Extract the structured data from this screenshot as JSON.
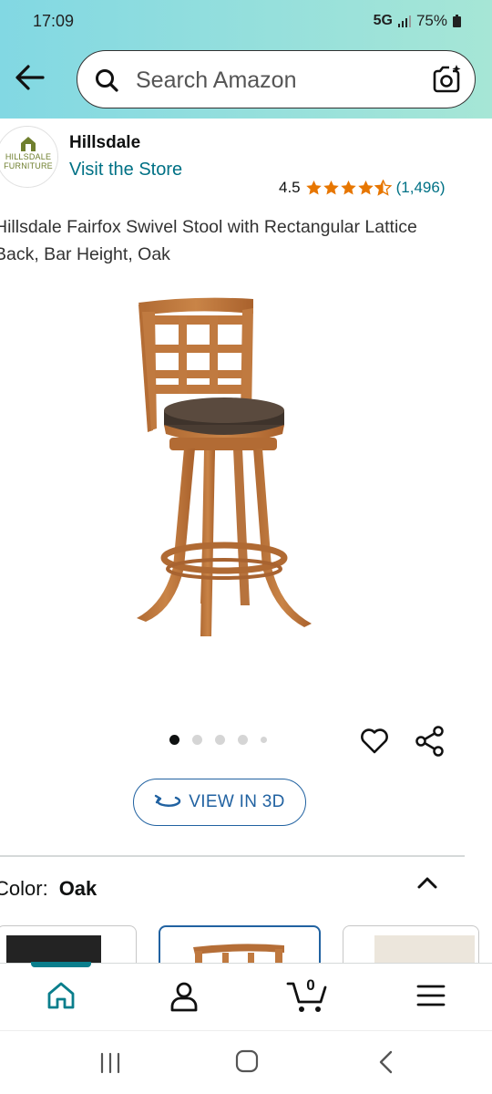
{
  "status_bar": {
    "time": "17:09",
    "network": "5G",
    "battery": "75%"
  },
  "search": {
    "placeholder": "Search Amazon"
  },
  "brand": {
    "name": "Hillsdale",
    "visit_store": "Visit the Store",
    "logo_text_line1": "HILLSDALE",
    "logo_text_line2": "FURNITURE"
  },
  "rating": {
    "value": "4.5",
    "stars": 4.5,
    "count": "(1,496)",
    "star_color": "#e77600"
  },
  "product": {
    "title": "Hillsdale Fairfox Swivel Stool with Rectangular Lattice Back, Bar Height, Oak"
  },
  "carousel": {
    "total_dots": 5,
    "active_index": 0
  },
  "view3d": {
    "label": "VIEW IN 3D",
    "icon": "rotate-3d-icon"
  },
  "color": {
    "label": "Color:",
    "value": "Oak"
  },
  "swatches": [
    {
      "name": "black",
      "color": "#232323"
    },
    {
      "name": "oak",
      "color": "#b8733a",
      "selected": true
    },
    {
      "name": "cream",
      "color": "#ece6dc"
    }
  ],
  "bottom_nav": {
    "items": [
      {
        "icon": "home-icon",
        "active": true
      },
      {
        "icon": "account-icon"
      },
      {
        "icon": "cart-icon"
      },
      {
        "icon": "menu-icon"
      }
    ],
    "cart_count": "0",
    "accent": "#0a7e8c"
  },
  "colors": {
    "link": "#007185",
    "view3d_accent": "#2162a1",
    "header_start": "#82d8e3",
    "header_end": "#a6e6d6"
  }
}
